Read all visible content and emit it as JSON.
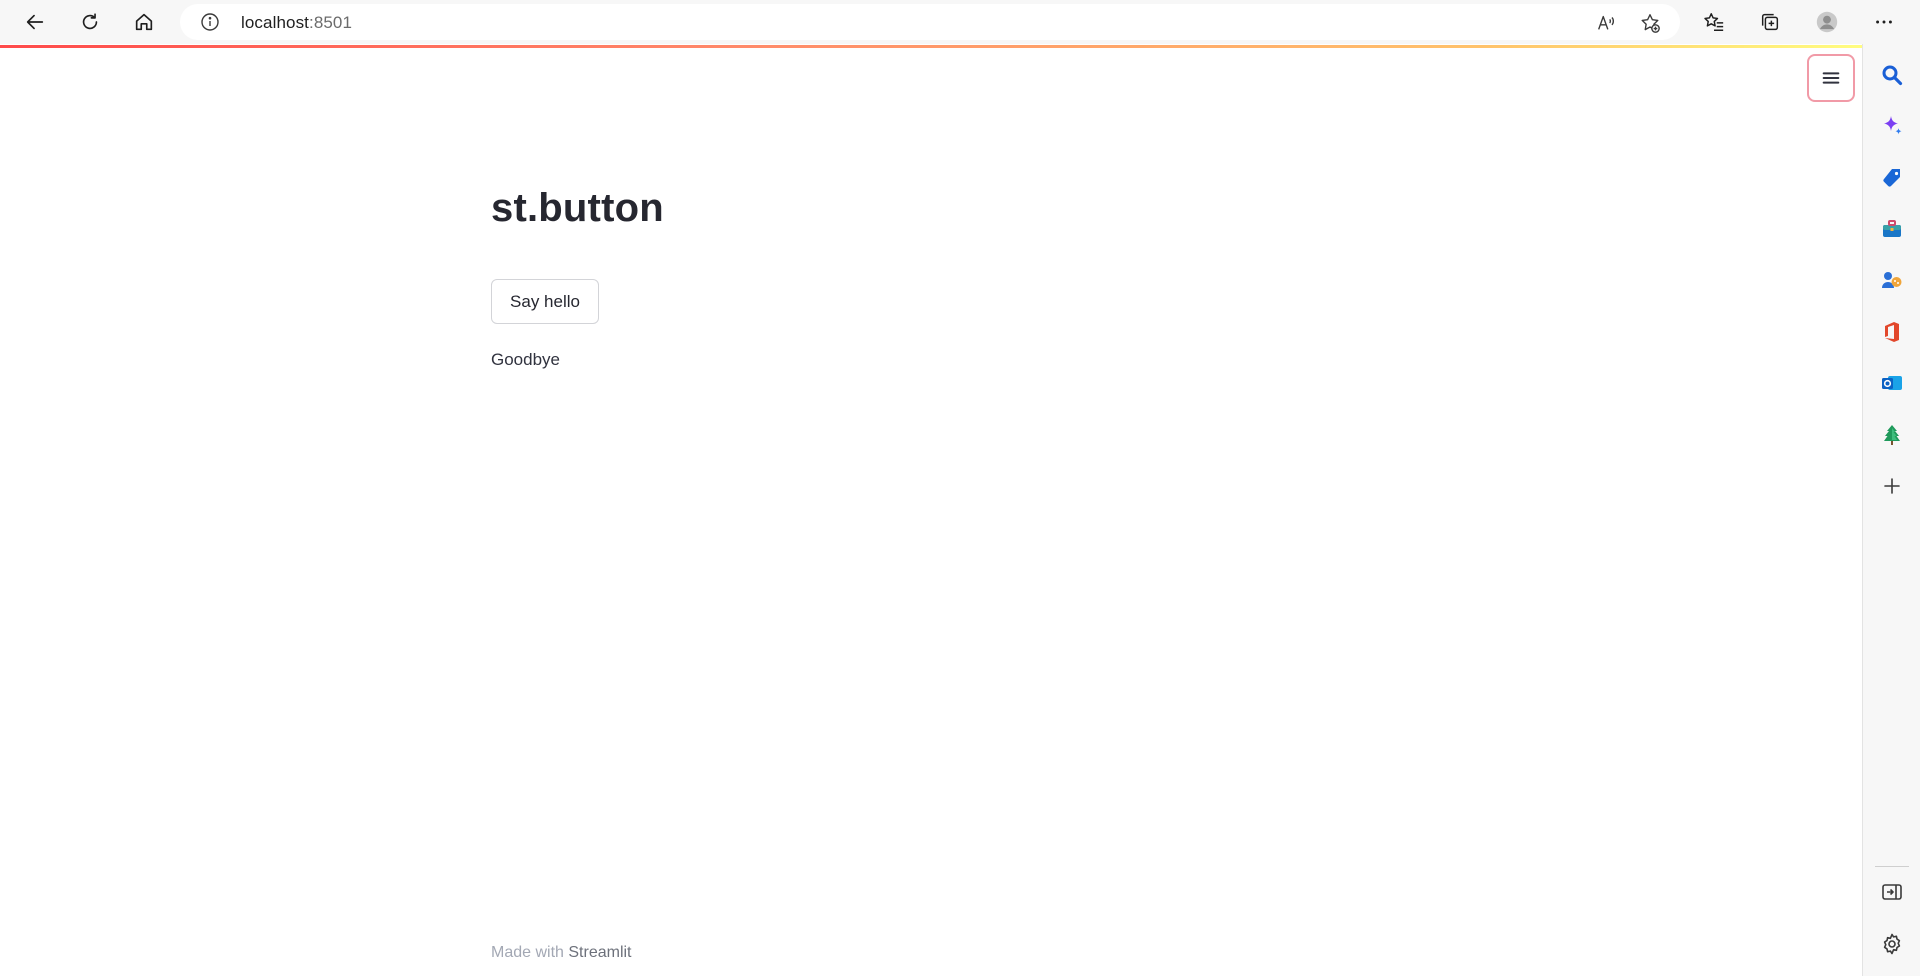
{
  "browser": {
    "url_host": "localhost",
    "url_port": ":8501",
    "icons": {
      "back": "back-arrow-icon",
      "refresh": "refresh-icon",
      "home": "home-icon",
      "info": "info-icon",
      "read_aloud": "read-aloud-icon",
      "add_favorite": "add-favorite-icon",
      "favorites": "favorites-icon",
      "collections": "collections-icon",
      "profile": "profile-avatar-icon",
      "more": "more-dots-icon"
    }
  },
  "app": {
    "title": "st.button",
    "button_label": "Say hello",
    "output_text": "Goodbye",
    "footer_prefix": "Made with ",
    "footer_brand": "Streamlit",
    "accent_color": "#ff4b4b"
  },
  "sidebar": {
    "icons": [
      "search-icon",
      "copilot-icon",
      "shopping-icon",
      "tools-icon",
      "games-icon",
      "office-icon",
      "outlook-icon",
      "tree-icon",
      "add-icon",
      "hide-sidebar-icon",
      "settings-icon"
    ]
  }
}
